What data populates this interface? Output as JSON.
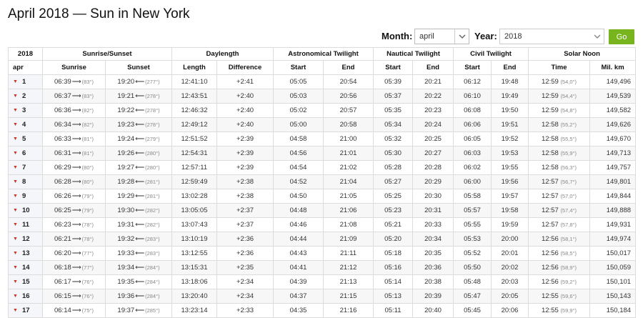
{
  "title": "April 2018 — Sun in New York",
  "controls": {
    "month_label": "Month:",
    "month_value": "april",
    "year_label": "Year:",
    "year_value": "2018",
    "go_label": "Go"
  },
  "headers": {
    "year": "2018",
    "month": "apr",
    "groups": [
      "Sunrise/Sunset",
      "Daylength",
      "Astronomical Twilight",
      "Nautical Twilight",
      "Civil Twilight",
      "Solar Noon"
    ],
    "sub": [
      "Sunrise",
      "Sunset",
      "Length",
      "Difference",
      "Start",
      "End",
      "Start",
      "End",
      "Start",
      "End",
      "Time",
      "Mil. km"
    ]
  },
  "colors": {
    "accent_green": "#78b41e",
    "caret_red": "#c0392b"
  },
  "rows": [
    {
      "day": "1",
      "sunrise": "06:39",
      "sr_az": "(83°)",
      "sunset": "19:20",
      "ss_az": "(277°)",
      "length": "12:41:10",
      "diff": "+2:41",
      "astro_start": "05:05",
      "astro_end": "20:54",
      "naut_start": "05:39",
      "naut_end": "20:21",
      "civil_start": "06:12",
      "civil_end": "19:48",
      "noon": "12:59",
      "noon_alt": "(54,0°)",
      "dist": "149,496"
    },
    {
      "day": "2",
      "sunrise": "06:37",
      "sr_az": "(83°)",
      "sunset": "19:21",
      "ss_az": "(278°)",
      "length": "12:43:51",
      "diff": "+2:40",
      "astro_start": "05:03",
      "astro_end": "20:56",
      "naut_start": "05:37",
      "naut_end": "20:22",
      "civil_start": "06:10",
      "civil_end": "19:49",
      "noon": "12:59",
      "noon_alt": "(54,4°)",
      "dist": "149,539"
    },
    {
      "day": "3",
      "sunrise": "06:36",
      "sr_az": "(82°)",
      "sunset": "19:22",
      "ss_az": "(278°)",
      "length": "12:46:32",
      "diff": "+2:40",
      "astro_start": "05:02",
      "astro_end": "20:57",
      "naut_start": "05:35",
      "naut_end": "20:23",
      "civil_start": "06:08",
      "civil_end": "19:50",
      "noon": "12:59",
      "noon_alt": "(54,8°)",
      "dist": "149,582"
    },
    {
      "day": "4",
      "sunrise": "06:34",
      "sr_az": "(82°)",
      "sunset": "19:23",
      "ss_az": "(278°)",
      "length": "12:49:12",
      "diff": "+2:40",
      "astro_start": "05:00",
      "astro_end": "20:58",
      "naut_start": "05:34",
      "naut_end": "20:24",
      "civil_start": "06:06",
      "civil_end": "19:51",
      "noon": "12:58",
      "noon_alt": "(55,2°)",
      "dist": "149,626"
    },
    {
      "day": "5",
      "sunrise": "06:33",
      "sr_az": "(81°)",
      "sunset": "19:24",
      "ss_az": "(279°)",
      "length": "12:51:52",
      "diff": "+2:39",
      "astro_start": "04:58",
      "astro_end": "21:00",
      "naut_start": "05:32",
      "naut_end": "20:25",
      "civil_start": "06:05",
      "civil_end": "19:52",
      "noon": "12:58",
      "noon_alt": "(55,5°)",
      "dist": "149,670"
    },
    {
      "day": "6",
      "sunrise": "06:31",
      "sr_az": "(81°)",
      "sunset": "19:26",
      "ss_az": "(280°)",
      "length": "12:54:31",
      "diff": "+2:39",
      "astro_start": "04:56",
      "astro_end": "21:01",
      "naut_start": "05:30",
      "naut_end": "20:27",
      "civil_start": "06:03",
      "civil_end": "19:53",
      "noon": "12:58",
      "noon_alt": "(55,9°)",
      "dist": "149,713"
    },
    {
      "day": "7",
      "sunrise": "06:29",
      "sr_az": "(80°)",
      "sunset": "19:27",
      "ss_az": "(280°)",
      "length": "12:57:11",
      "diff": "+2:39",
      "astro_start": "04:54",
      "astro_end": "21:02",
      "naut_start": "05:28",
      "naut_end": "20:28",
      "civil_start": "06:02",
      "civil_end": "19:55",
      "noon": "12:58",
      "noon_alt": "(56,3°)",
      "dist": "149,757"
    },
    {
      "day": "8",
      "sunrise": "06:28",
      "sr_az": "(80°)",
      "sunset": "19:28",
      "ss_az": "(281°)",
      "length": "12:59:49",
      "diff": "+2:38",
      "astro_start": "04:52",
      "astro_end": "21:04",
      "naut_start": "05:27",
      "naut_end": "20:29",
      "civil_start": "06:00",
      "civil_end": "19:56",
      "noon": "12:57",
      "noon_alt": "(56,7°)",
      "dist": "149,801"
    },
    {
      "day": "9",
      "sunrise": "06:26",
      "sr_az": "(79°)",
      "sunset": "19:29",
      "ss_az": "(281°)",
      "length": "13:02:28",
      "diff": "+2:38",
      "astro_start": "04:50",
      "astro_end": "21:05",
      "naut_start": "05:25",
      "naut_end": "20:30",
      "civil_start": "05:58",
      "civil_end": "19:57",
      "noon": "12:57",
      "noon_alt": "(57,0°)",
      "dist": "149,844"
    },
    {
      "day": "10",
      "sunrise": "06:25",
      "sr_az": "(79°)",
      "sunset": "19:30",
      "ss_az": "(282°)",
      "length": "13:05:05",
      "diff": "+2:37",
      "astro_start": "04:48",
      "astro_end": "21:06",
      "naut_start": "05:23",
      "naut_end": "20:31",
      "civil_start": "05:57",
      "civil_end": "19:58",
      "noon": "12:57",
      "noon_alt": "(57,4°)",
      "dist": "149,888"
    },
    {
      "day": "11",
      "sunrise": "06:23",
      "sr_az": "(78°)",
      "sunset": "19:31",
      "ss_az": "(282°)",
      "length": "13:07:43",
      "diff": "+2:37",
      "astro_start": "04:46",
      "astro_end": "21:08",
      "naut_start": "05:21",
      "naut_end": "20:33",
      "civil_start": "05:55",
      "civil_end": "19:59",
      "noon": "12:57",
      "noon_alt": "(57,8°)",
      "dist": "149,931"
    },
    {
      "day": "12",
      "sunrise": "06:21",
      "sr_az": "(78°)",
      "sunset": "19:32",
      "ss_az": "(283°)",
      "length": "13:10:19",
      "diff": "+2:36",
      "astro_start": "04:44",
      "astro_end": "21:09",
      "naut_start": "05:20",
      "naut_end": "20:34",
      "civil_start": "05:53",
      "civil_end": "20:00",
      "noon": "12:56",
      "noon_alt": "(58,1°)",
      "dist": "149,974"
    },
    {
      "day": "13",
      "sunrise": "06:20",
      "sr_az": "(77°)",
      "sunset": "19:33",
      "ss_az": "(283°)",
      "length": "13:12:55",
      "diff": "+2:36",
      "astro_start": "04:43",
      "astro_end": "21:11",
      "naut_start": "05:18",
      "naut_end": "20:35",
      "civil_start": "05:52",
      "civil_end": "20:01",
      "noon": "12:56",
      "noon_alt": "(58,5°)",
      "dist": "150,017"
    },
    {
      "day": "14",
      "sunrise": "06:18",
      "sr_az": "(77°)",
      "sunset": "19:34",
      "ss_az": "(284°)",
      "length": "13:15:31",
      "diff": "+2:35",
      "astro_start": "04:41",
      "astro_end": "21:12",
      "naut_start": "05:16",
      "naut_end": "20:36",
      "civil_start": "05:50",
      "civil_end": "20:02",
      "noon": "12:56",
      "noon_alt": "(58,9°)",
      "dist": "150,059"
    },
    {
      "day": "15",
      "sunrise": "06:17",
      "sr_az": "(76°)",
      "sunset": "19:35",
      "ss_az": "(284°)",
      "length": "13:18:06",
      "diff": "+2:34",
      "astro_start": "04:39",
      "astro_end": "21:13",
      "naut_start": "05:14",
      "naut_end": "20:38",
      "civil_start": "05:48",
      "civil_end": "20:03",
      "noon": "12:56",
      "noon_alt": "(59,2°)",
      "dist": "150,101"
    },
    {
      "day": "16",
      "sunrise": "06:15",
      "sr_az": "(76°)",
      "sunset": "19:36",
      "ss_az": "(284°)",
      "length": "13:20:40",
      "diff": "+2:34",
      "astro_start": "04:37",
      "astro_end": "21:15",
      "naut_start": "05:13",
      "naut_end": "20:39",
      "civil_start": "05:47",
      "civil_end": "20:05",
      "noon": "12:55",
      "noon_alt": "(59,6°)",
      "dist": "150,143"
    },
    {
      "day": "17",
      "sunrise": "06:14",
      "sr_az": "(75°)",
      "sunset": "19:37",
      "ss_az": "(285°)",
      "length": "13:23:14",
      "diff": "+2:33",
      "astro_start": "04:35",
      "astro_end": "21:16",
      "naut_start": "05:11",
      "naut_end": "20:40",
      "civil_start": "05:45",
      "civil_end": "20:06",
      "noon": "12:55",
      "noon_alt": "(59,9°)",
      "dist": "150,184"
    }
  ]
}
